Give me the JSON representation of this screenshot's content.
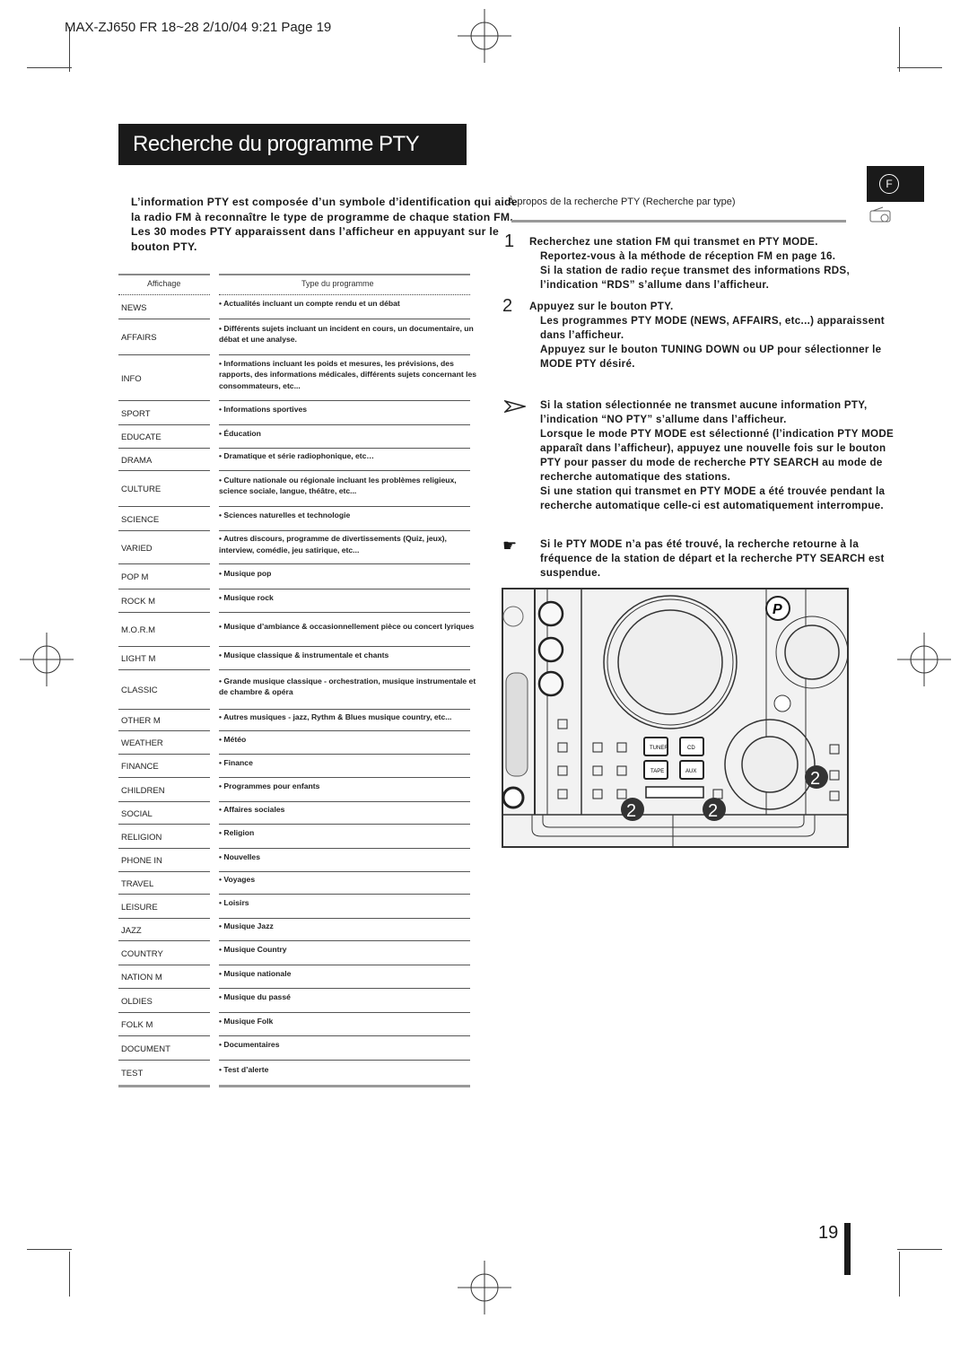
{
  "print_header": "MAX-ZJ650 FR 18~28  2/10/04 9:21  Page 19",
  "title": "Recherche du programme PTY",
  "language_badge": "F",
  "intro": {
    "paragraph1": "L’information PTY est composée d’un symbole d’identification qui aide la radio FM à reconnaître le type de programme de chaque station FM.",
    "paragraph2": "Les 30 modes PTY apparaissent dans l’afficheur en appuyant sur le bouton PTY."
  },
  "table": {
    "headers": [
      "Affichage",
      "Type du programme"
    ],
    "rows": [
      {
        "code": "NEWS",
        "desc": "• Actualités incluant un compte rendu et un débat"
      },
      {
        "code": "AFFAIRS",
        "desc": "• Différents sujets incluant un incident en cours, un documentaire, un débat et une analyse."
      },
      {
        "code": "INFO",
        "desc": "• Informations incluant les poids et mesures, les prévisions, des rapports, des informations médicales, différents sujets concernant les consommateurs, etc..."
      },
      {
        "code": "SPORT",
        "desc": "• Informations sportives"
      },
      {
        "code": "EDUCATE",
        "desc": "• Éducation"
      },
      {
        "code": "DRAMA",
        "desc": "• Dramatique et série radiophonique, etc…"
      },
      {
        "code": "CULTURE",
        "desc": "• Culture nationale ou régionale incluant les problèmes religieux, science sociale, langue, théâtre, etc..."
      },
      {
        "code": "SCIENCE",
        "desc": "• Sciences naturelles et technologie"
      },
      {
        "code": "VARIED",
        "desc": "• Autres discours, programme de divertissements (Quiz, jeux), interview, comédie, jeu satirique, etc..."
      },
      {
        "code": "POP M",
        "desc": "• Musique pop"
      },
      {
        "code": "ROCK M",
        "desc": "• Musique rock"
      },
      {
        "code": "M.O.R.M",
        "desc": "• Musique d’ambiance & occasionnellement pièce ou concert lyriques"
      },
      {
        "code": "LIGHT M",
        "desc": "• Musique classique & instrumentale et chants"
      },
      {
        "code": "CLASSIC",
        "desc": "• Grande musique classique - orchestration, musique instrumentale et de chambre & opéra"
      },
      {
        "code": "OTHER M",
        "desc": "• Autres musiques - jazz, Rythm & Blues musique country, etc..."
      },
      {
        "code": "WEATHER",
        "desc": "• Météo"
      },
      {
        "code": "FINANCE",
        "desc": "• Finance"
      },
      {
        "code": "CHILDREN",
        "desc": "• Programmes pour enfants"
      },
      {
        "code": "SOCIAL",
        "desc": "• Affaires sociales"
      },
      {
        "code": "RELIGION",
        "desc": "• Religion"
      },
      {
        "code": "PHONE IN",
        "desc": "• Nouvelles"
      },
      {
        "code": "TRAVEL",
        "desc": "• Voyages"
      },
      {
        "code": "LEISURE",
        "desc": "• Loisirs"
      },
      {
        "code": "JAZZ",
        "desc": "• Musique Jazz"
      },
      {
        "code": "COUNTRY",
        "desc": "• Musique Country"
      },
      {
        "code": "NATION M",
        "desc": "• Musique nationale"
      },
      {
        "code": "OLDIES",
        "desc": "• Musique du passé"
      },
      {
        "code": "FOLK M",
        "desc": "• Musique Folk"
      },
      {
        "code": "DOCUMENT",
        "desc": "• Documentaires"
      },
      {
        "code": "TEST",
        "desc": "• Test d’alerte"
      }
    ]
  },
  "right": {
    "heading": "À propos de la recherche  PTY  (Recherche par type)",
    "steps": [
      {
        "num": "1",
        "lines": [
          "Recherchez une station FM qui transmet en PTY MODE.",
          "Reportez-vous à la méthode de réception FM en page 16.",
          "Si la station de radio reçue transmet des informations RDS, l’indication “RDS” s’allume dans l’afficheur."
        ]
      },
      {
        "num": "2",
        "lines": [
          "Appuyez sur le bouton PTY.",
          "Les programmes PTY MODE (NEWS, AFFAIRS, etc...) apparaissent dans l’afficheur.",
          "Appuyez sur le bouton TUNING DOWN ou UP pour sélectionner le MODE PTY désiré."
        ]
      }
    ],
    "note": {
      "icon": "arrow-pointer-icon",
      "lines": [
        "Si la station sélectionnée ne transmet aucune information PTY, l’indication “NO PTY” s’allume dans l’afficheur.",
        "Lorsque le mode PTY MODE est sélectionné (l’indication PTY MODE apparaît dans l’afficheur), appuyez une nouvelle fois sur le bouton PTY pour passer  du mode de recherche PTY SEARCH au mode de recherche automatique des stations.",
        "Si une station qui transmet en PTY MODE a été trouvée pendant la recherche automatique celle-ci est automatiquement interrompue."
      ]
    },
    "tip": {
      "icon": "pointing-hand-icon",
      "text": "Si le PTY MODE n’a pas été trouvé, la recherche retourne à la fréquence de la station de départ et la recherche PTY SEARCH est suspendue."
    }
  },
  "device": {
    "buttons": [
      "TUNER",
      "CD",
      "TAPE",
      "AUX"
    ],
    "callout": "2"
  },
  "page_number": "19"
}
